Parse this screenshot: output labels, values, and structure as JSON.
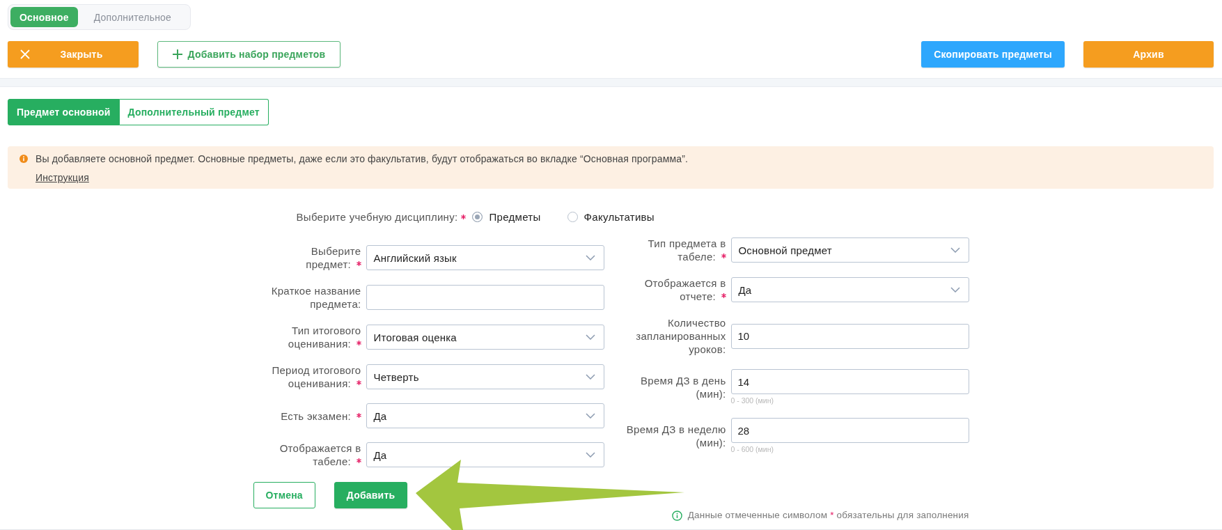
{
  "mode_tabs": [
    {
      "label": "Основное",
      "selected": true
    },
    {
      "label": "Дополнительное",
      "selected": false
    }
  ],
  "toolbar": {
    "left": [
      {
        "kind": "close",
        "label": "Закрыть"
      },
      {
        "kind": "add",
        "label": "Добавить набор предметов"
      }
    ],
    "right": [
      {
        "kind": "primary",
        "label": "Скопировать предметы"
      },
      {
        "kind": "accent",
        "label": "Архив"
      }
    ]
  },
  "subject_tabs": [
    {
      "label": "Предмет основной",
      "selected": true
    },
    {
      "label": "Дополнительный предмет",
      "selected": false
    }
  ],
  "notice": {
    "text": "Вы добавляете основной предмет. Основные предметы, даже если это факультатив, будут отображаться во вкладке “Основная программа”.",
    "link": "Инструкция"
  },
  "discipline": {
    "label": "Выберите учебную дисциплину:",
    "required": true,
    "options": [
      {
        "label": "Предметы",
        "selected": true
      },
      {
        "label": "Факультативы",
        "selected": false
      }
    ]
  },
  "left_fields": [
    {
      "kind": "select",
      "label": "Выберите предмет:",
      "required": true,
      "value": "Английский язык"
    },
    {
      "kind": "text",
      "label": "Краткое название предмета:",
      "required": false
    },
    {
      "kind": "select",
      "label": "Тип итогового оценивания:",
      "required": true,
      "value": "Итоговая оценка"
    },
    {
      "kind": "select",
      "label": "Период итогового оценивания:",
      "required": true,
      "value": "Четверть"
    },
    {
      "kind": "select",
      "label": "Есть экзамен:",
      "required": true,
      "value": "Да"
    },
    {
      "kind": "select",
      "label": "Отображается в табеле:",
      "required": true,
      "value": "Да"
    }
  ],
  "right_fields": [
    {
      "kind": "select",
      "label": "Тип предмета в табеле:",
      "required": true,
      "value": "Основной предмет"
    },
    {
      "kind": "select",
      "label": "Отображается в отчете:",
      "required": true,
      "value": "Да"
    },
    {
      "kind": "text",
      "label": "Количество запланированных уроков:",
      "required": false,
      "value": "10"
    },
    {
      "kind": "text",
      "label": "Время ДЗ в день (мин):",
      "required": false,
      "value": "14",
      "hint": "0 - 300 (мин)"
    },
    {
      "kind": "text",
      "label": "Время ДЗ в неделю (мин):",
      "required": false,
      "value": "28",
      "hint": "0 - 600 (мин)"
    }
  ],
  "actions": [
    {
      "kind": "outline",
      "label": "Отмена"
    },
    {
      "kind": "primary",
      "label": "Добавить"
    }
  ],
  "footnote": {
    "before": "Данные отмеченные символом",
    "mark": "*",
    "after": "обязательны для заполнения"
  }
}
